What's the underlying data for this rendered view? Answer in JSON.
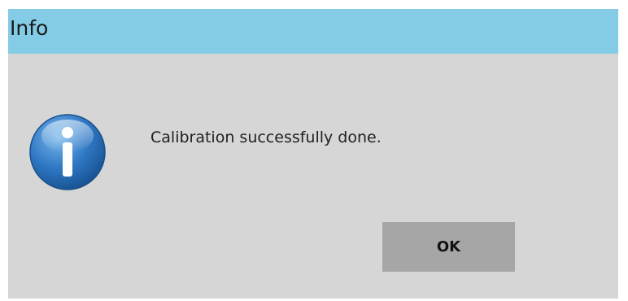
{
  "dialog": {
    "title": "Info",
    "message": "Calibration successfully done.",
    "icon": "info-icon",
    "ok_label": "OK"
  },
  "colors": {
    "titlebar": "#84cbe6",
    "body": "#d6d6d6",
    "button": "#a6a6a6",
    "icon_blue": "#1f68b8"
  }
}
